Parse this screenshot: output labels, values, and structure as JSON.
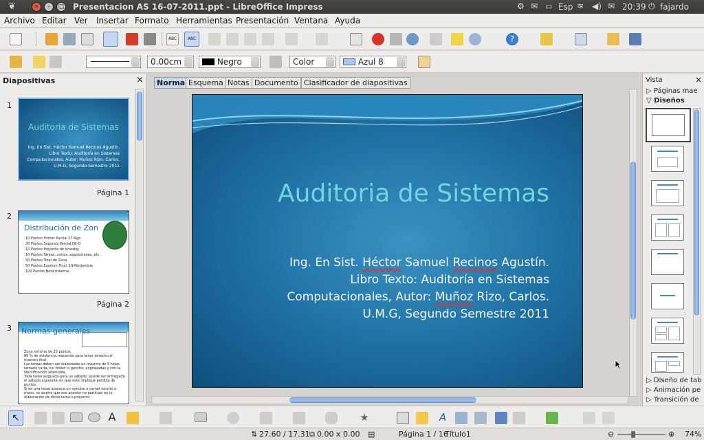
{
  "window": {
    "title": "Presentacion AS 16-07-2011.ppt - LibreOffice Impress",
    "keyboard_layout": "Esp",
    "clock": "20:39",
    "user": "fajardo"
  },
  "menubar": [
    "Archivo",
    "Editar",
    "Ver",
    "Insertar",
    "Formato",
    "Herramientas",
    "Presentación",
    "Ventana",
    "Ayuda"
  ],
  "line_toolbar": {
    "line_width": "0.00cm",
    "line_color": "Negro",
    "area_style": "Color",
    "area_color": "Azul 8"
  },
  "left_panel": {
    "title": "Diapositivas",
    "slides": [
      {
        "number": "1",
        "label": "Página 1",
        "title": "Auditoria de Sistemas",
        "lines": [
          "Ing. En Sist. Héctor Samuel Recinos Agustín.",
          "Libro Texto: Auditoría en Sistemas",
          "Computacionales, Autor: Muñoz Rizo, Carlos.",
          "U.M.G, Segundo Semestre 2011"
        ]
      },
      {
        "number": "2",
        "label": "Página 2",
        "title": "Distribución de Zon",
        "items": [
          "10 Puntos     Primer Parcial 27-Ago",
          "20 Puntos     Segundo Parcial 08-O",
          "10 Puntos     Proyecto de investig",
          "10 Puntos     Tareas, cortos, exposiciones, etc.",
          "50 Puntos     Total de Zona.",
          "50 Puntos     Examen Final. 19-Noviembre",
          "100 Puntos    Nota máxima."
        ]
      },
      {
        "number": "3",
        "label": "",
        "title": "Normas generales",
        "items": [
          "Zona mínima de 20 puntos.",
          "80 % de asistencia requerido para tener derecho al examen final.",
          "Las tareas deben ser elaboradas un máximo de 5 hojas tamaño carta, sin folder ni gancho, engrapadas y con la identificación adecuada.",
          "Toda tarea asignada para un sábado, puede ser entregada el sábado siguiente sin que esto implique pérdida de puntos.",
          "Si en una tarea aparece un nombre o carnet escrito a mano, se asume que ese alumno no participó en la elaboración de dicha tarea o proyecto."
        ]
      }
    ]
  },
  "view_tabs": [
    "Normal",
    "Esquema",
    "Notas",
    "Documento",
    "Clasificador de diapositivas"
  ],
  "active_tab": "Normal",
  "slide": {
    "title": "Auditoria de Sistemas",
    "lines": [
      {
        "pre": "Ing. En Sist. ",
        "sq": "Héctor",
        "mid": " Samuel ",
        "sq2": "Recinos",
        "post": " Agustín."
      },
      {
        "pre": "Libro Texto: Auditoría en Sistemas",
        "sq": "",
        "mid": "",
        "sq2": "",
        "post": ""
      },
      {
        "pre": "Computacionales, Autor: ",
        "sq": "Muñoz",
        "mid": " Rizo, Carlos.",
        "sq2": "",
        "post": ""
      },
      {
        "pre": "U.M.G, Segundo Semestre 2011",
        "sq": "",
        "mid": "",
        "sq2": "",
        "post": ""
      }
    ]
  },
  "right_panel": {
    "title": "Vista",
    "sections": [
      "Páginas mae",
      "Diseños"
    ],
    "bottom_sections": [
      "Diseño de tab",
      "Animación pe",
      "Transición de"
    ]
  },
  "status": {
    "position": "27.60 / 17.31",
    "size": "0.00 x 0.00",
    "page": "Página 1 / 16",
    "master": "Título1",
    "zoom": "74%"
  },
  "colors": {
    "slide_title": "#6fd4de",
    "slide_bg": "#2275a8",
    "highlight": "#7fb0e8"
  }
}
